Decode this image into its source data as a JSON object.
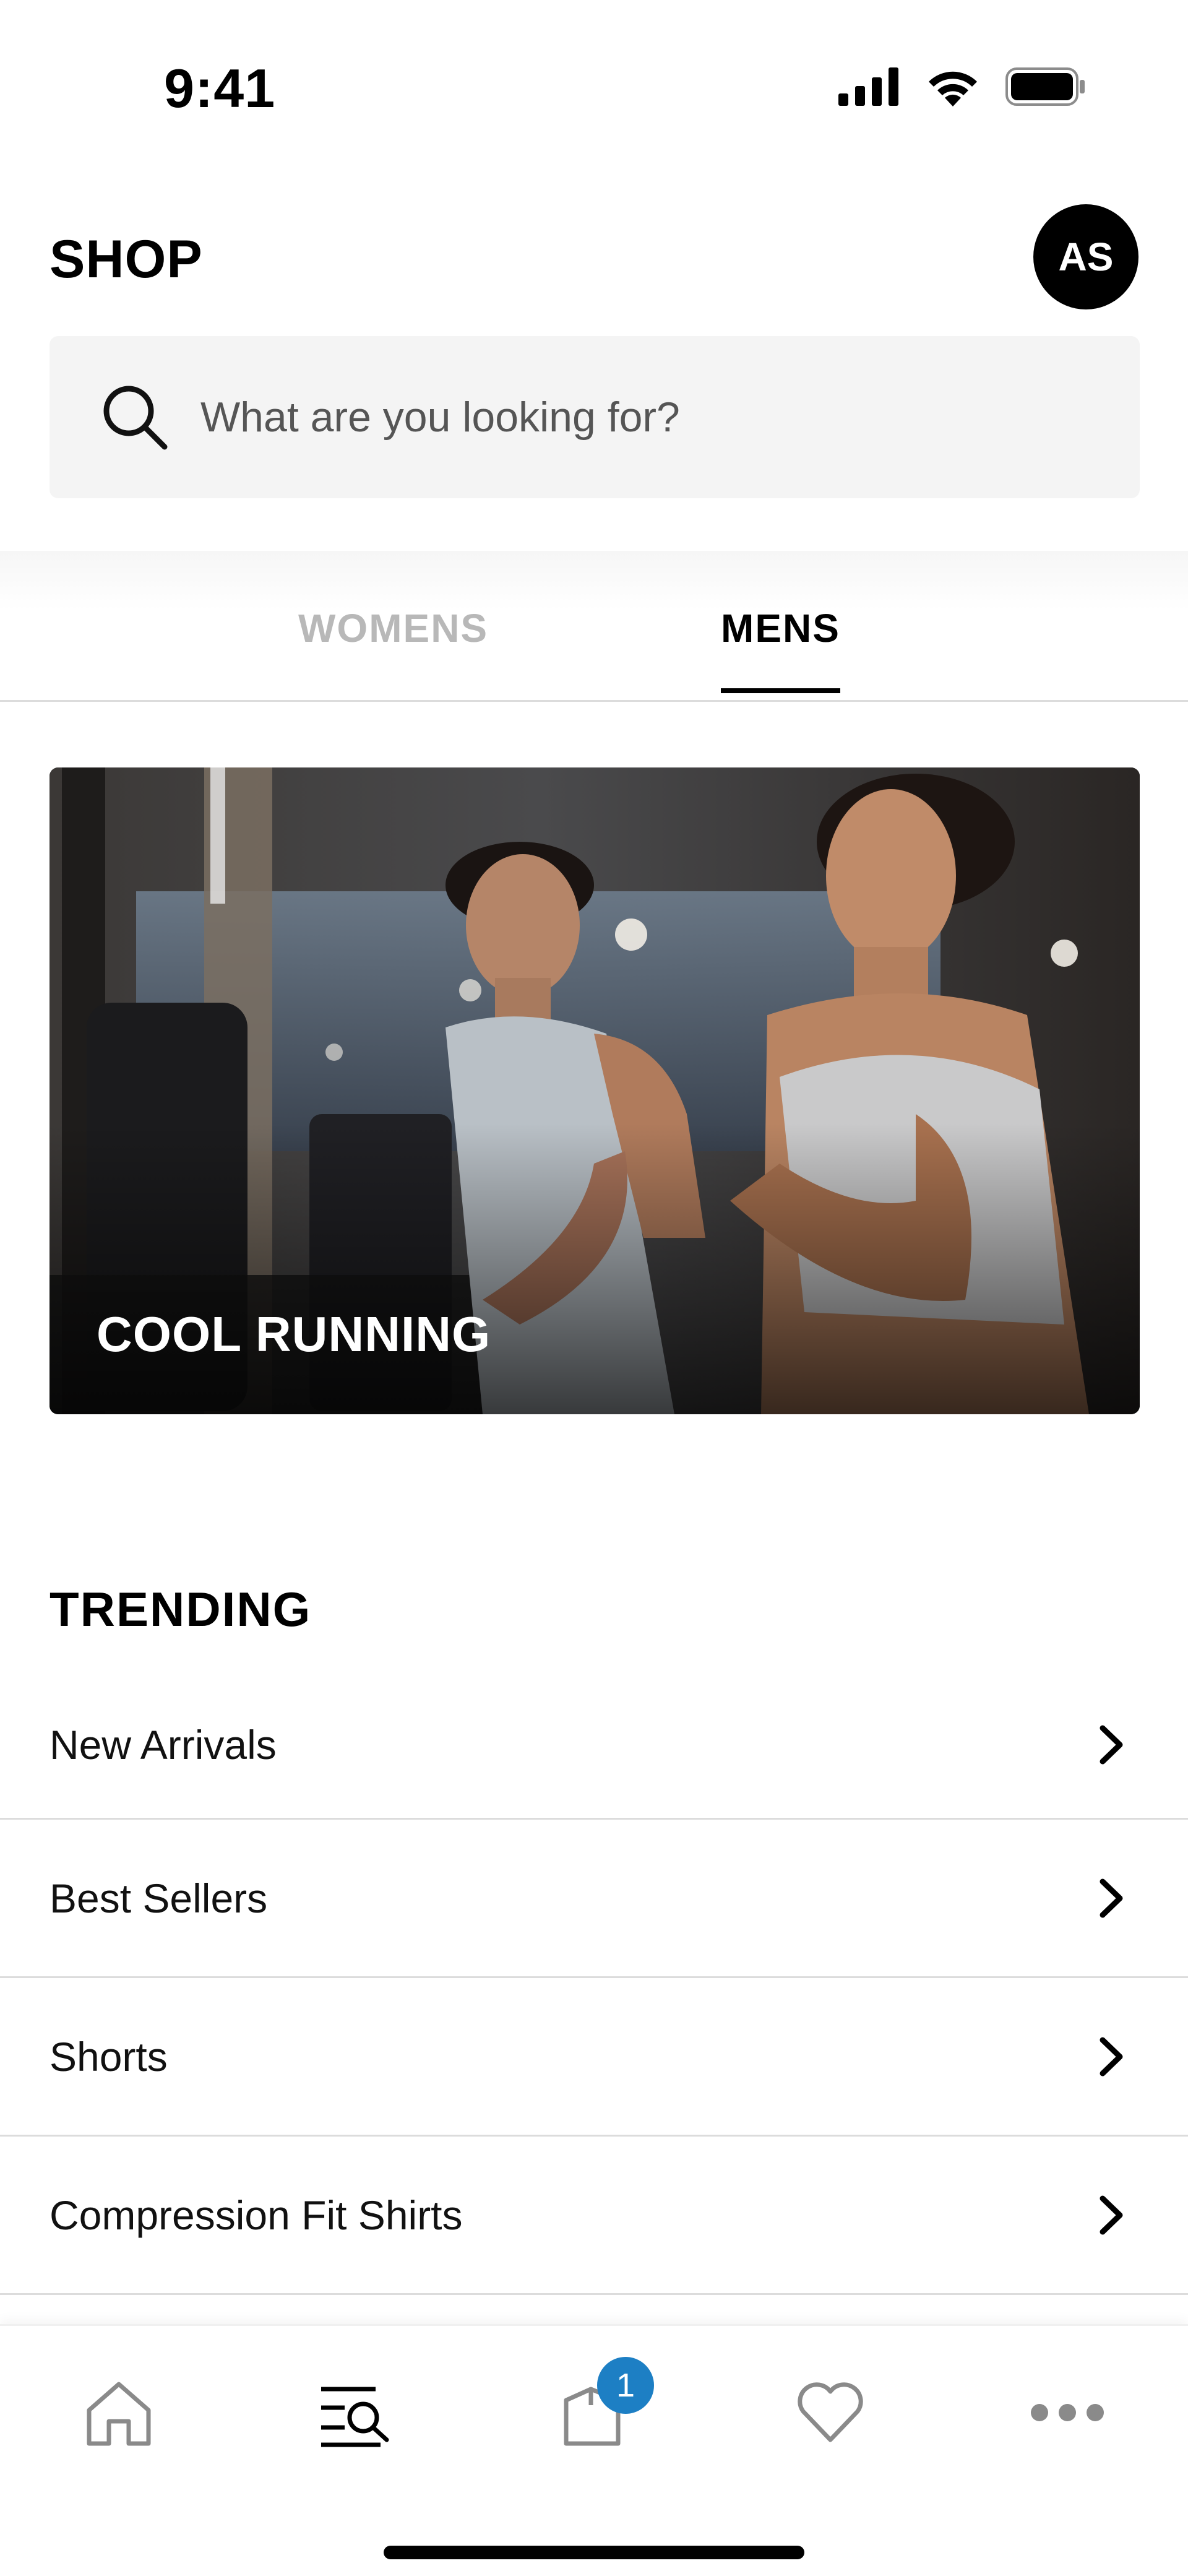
{
  "status_bar": {
    "time": "9:41"
  },
  "header": {
    "title": "SHOP",
    "avatar_initials": "AS"
  },
  "search": {
    "placeholder": "What are you looking for?"
  },
  "tabs": [
    {
      "label": "WOMENS",
      "active": false
    },
    {
      "label": "MENS",
      "active": true
    }
  ],
  "hero": {
    "title": "COOL RUNNING"
  },
  "trending": {
    "title": "TRENDING",
    "items": [
      {
        "label": "New Arrivals"
      },
      {
        "label": "Best Sellers"
      },
      {
        "label": "Shorts"
      },
      {
        "label": "Compression Fit Shirts"
      }
    ]
  },
  "bottom_nav": {
    "items": [
      {
        "icon": "home-icon"
      },
      {
        "icon": "shop-search-icon",
        "active": true
      },
      {
        "icon": "bag-icon"
      },
      {
        "icon": "heart-icon"
      },
      {
        "icon": "more-icon"
      }
    ],
    "cart_count": "1"
  },
  "colors": {
    "accent": "#1d7fc4",
    "text": "#000000",
    "muted": "#b8b8b8",
    "surface": "#f4f4f4"
  }
}
